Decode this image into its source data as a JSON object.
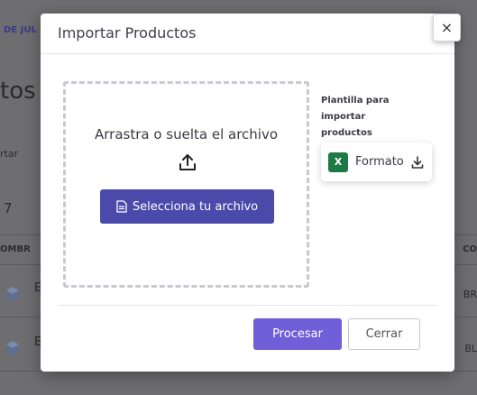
{
  "background": {
    "top_link": "DE JUL",
    "title_fragment": "tos",
    "filter_fragment": "rtar",
    "count_fragment": "7",
    "col_left": "OMBR",
    "col_right": "CO",
    "rows": [
      {
        "letter": "E",
        "code": "BR"
      },
      {
        "letter": "E",
        "code": "BL"
      }
    ]
  },
  "modal": {
    "title": "Importar Productos",
    "close_label": "×",
    "dropzone_text": "Arrastra o suelta el archivo",
    "select_button_label": "Selecciona tu archivo",
    "template_label": "Plantilla para importar productos",
    "format_label": "Formato",
    "excel_letter": "X",
    "process_button_label": "Procesar",
    "close_button_label": "Cerrar"
  },
  "colors": {
    "primary": "#4b4aab",
    "process": "#6f5fd8",
    "excel": "#1e7a45"
  }
}
